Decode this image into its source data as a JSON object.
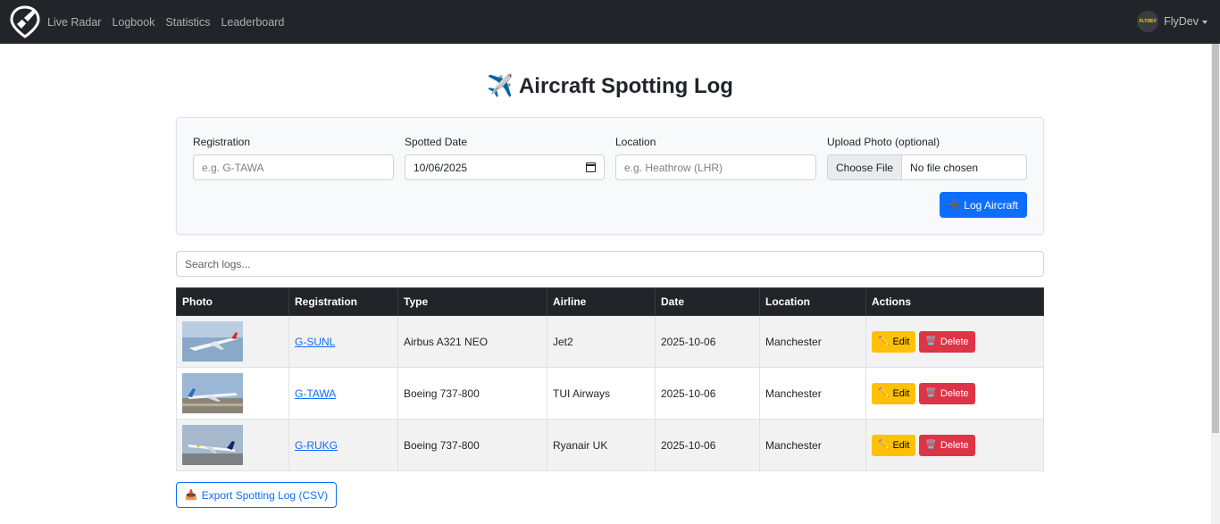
{
  "nav": {
    "links": [
      "Live Radar",
      "Logbook",
      "Statistics",
      "Leaderboard"
    ],
    "user": {
      "name": "FlyDev",
      "avatar_text": "FLYDEV"
    }
  },
  "page": {
    "title_icon": "✈️",
    "title": "Aircraft Spotting Log"
  },
  "form": {
    "registration": {
      "label": "Registration",
      "placeholder": "e.g. G-TAWA"
    },
    "spotted_date": {
      "label": "Spotted Date",
      "value": "10/06/2025"
    },
    "location": {
      "label": "Location",
      "placeholder": "e.g. Heathrow (LHR)"
    },
    "photo": {
      "label": "Upload Photo (optional)",
      "button": "Choose File",
      "status": "No file chosen"
    },
    "submit": {
      "icon": "➕",
      "label": "Log Aircraft"
    }
  },
  "search": {
    "placeholder": "Search logs..."
  },
  "table": {
    "headers": [
      "Photo",
      "Registration",
      "Type",
      "Airline",
      "Date",
      "Location",
      "Actions"
    ],
    "rows": [
      {
        "registration": "G-SUNL",
        "type": "Airbus A321 NEO",
        "airline": "Jet2",
        "date": "2025-10-06",
        "location": "Manchester"
      },
      {
        "registration": "G-TAWA",
        "type": "Boeing 737-800",
        "airline": "TUI Airways",
        "date": "2025-10-06",
        "location": "Manchester"
      },
      {
        "registration": "G-RUKG",
        "type": "Boeing 737-800",
        "airline": "Ryanair UK",
        "date": "2025-10-06",
        "location": "Manchester"
      }
    ],
    "actions": {
      "edit_icon": "✏️",
      "edit": "Edit",
      "delete_icon": "🗑️",
      "delete": "Delete"
    }
  },
  "export": {
    "icon": "📥",
    "label": "Export Spotting Log (CSV)"
  },
  "colors": {
    "navbar": "#212529",
    "primary": "#0d6efd",
    "warning": "#ffc107",
    "danger": "#dc3545"
  }
}
